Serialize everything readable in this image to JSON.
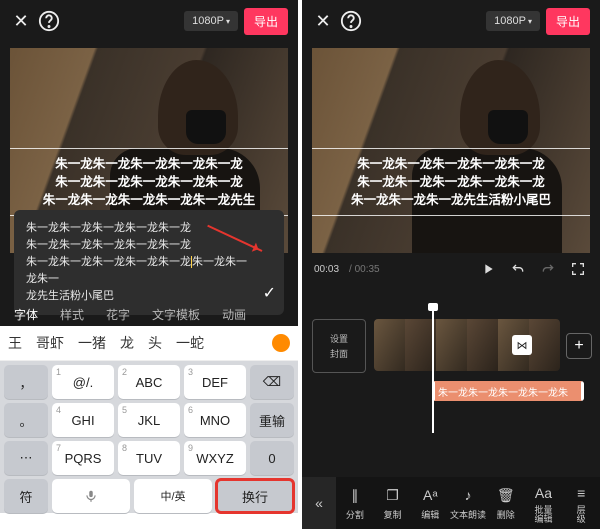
{
  "header": {
    "resolution": "1080P",
    "export": "导出"
  },
  "captions": {
    "line1": "朱一龙朱一龙朱一龙朱一龙朱一龙",
    "line2": "朱一龙朱一龙朱一龙朱一龙朱一龙",
    "line3": "朱一龙朱一龙朱一龙朱一龙朱一龙先生",
    "line3b": "朱一龙朱一龙朱一龙先生活粉小尾巴"
  },
  "editbox": {
    "l1": "朱一龙朱一龙朱一龙朱一龙朱一龙",
    "l2": "朱一龙朱一龙朱一龙朱一龙朱一龙",
    "l3a": "朱一龙朱一龙朱一龙朱一龙朱一龙",
    "l3b": "朱一龙朱一龙朱一",
    "l4": "龙先生活粉小尾巴"
  },
  "tabs": {
    "font": "字体",
    "style": "样式",
    "flower": "花字",
    "template": "文字模板",
    "anim": "动画"
  },
  "candidates": [
    "王",
    "哥虾",
    "一猪",
    "龙",
    "头",
    "一蛇"
  ],
  "keys": {
    "r1": [
      "@/.",
      "ABC",
      "DEF"
    ],
    "r2": [
      "GHI",
      "JKL",
      "MNO"
    ],
    "r3": [
      "PQRS",
      "TUV",
      "WXYZ"
    ],
    "side": {
      "back": "⌫",
      "reinput": "重输",
      "zero": "0",
      "comma": "，",
      "period": "。"
    },
    "bottom": {
      "symbol": "符",
      "lang": "中/英",
      "enter": "换行",
      "n1": "1",
      "n4": "4",
      "n7": "7",
      "n2": "2",
      "n5": "5",
      "n8": "8",
      "n3": "3",
      "n6": "6",
      "n9": "9"
    }
  },
  "time": {
    "cur": "00:03",
    "total": "00:35"
  },
  "cover": {
    "l1": "设置",
    "l2": "封面"
  },
  "texttrack": "朱一龙朱一龙朱一龙朱一龙朱",
  "tools": {
    "split": "分割",
    "copy": "复制",
    "edit": "编辑",
    "tts": "文本朗读",
    "del": "删除",
    "batch": "批量\n编辑",
    "layer": "层\n级"
  }
}
